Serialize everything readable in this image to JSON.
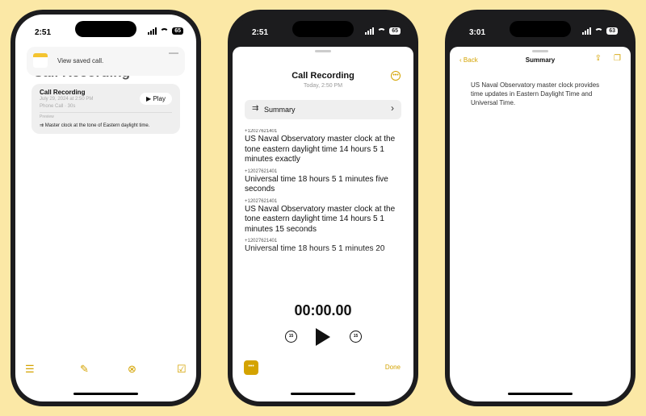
{
  "phone1": {
    "status_time": "2:51",
    "battery": "65",
    "toast_text": "View saved call.",
    "page_title": "Call Recording",
    "card": {
      "title": "Call Recording",
      "date": "July 29, 2024 at 2:50 PM",
      "meta": "Phone Call · 30s",
      "play_label": "Play",
      "section_label": "Preview",
      "summary_line": "Master clock at the tone of Eastern daylight time."
    },
    "toolbar_icons": [
      "checklist-icon",
      "paperclip-icon",
      "compass-icon",
      "compose-icon"
    ]
  },
  "phone2": {
    "status_time": "2:51",
    "battery": "65",
    "title": "Call Recording",
    "subtitle": "Today, 2:50 PM",
    "summary_label": "Summary",
    "transcript": [
      {
        "caller": "+12027621401",
        "text": "US Naval Observatory master clock at the tone eastern daylight time 14 hours 5 1 minutes exactly"
      },
      {
        "caller": "+12027621401",
        "text": "Universal time 18 hours 5 1 minutes five seconds"
      },
      {
        "caller": "+12027621401",
        "text": "US Naval Observatory master clock at the tone eastern daylight time 14 hours 5 1 minutes 15 seconds"
      },
      {
        "caller": "+12027621401",
        "text": "Universal time 18 hours 5 1 minutes 20"
      }
    ],
    "timer": "00:00.00",
    "skip_back": "15",
    "skip_forward": "15",
    "done_label": "Done"
  },
  "phone3": {
    "status_time": "3:01",
    "battery": "63",
    "back_label": "Back",
    "nav_title": "Summary",
    "summary_text": "US Naval Observatory master clock provides time updates in Eastern Daylight Time and Universal Time."
  },
  "colors": {
    "accent": "#d4a300",
    "background": "#fbe8a6",
    "frame": "#1c1c1e"
  }
}
